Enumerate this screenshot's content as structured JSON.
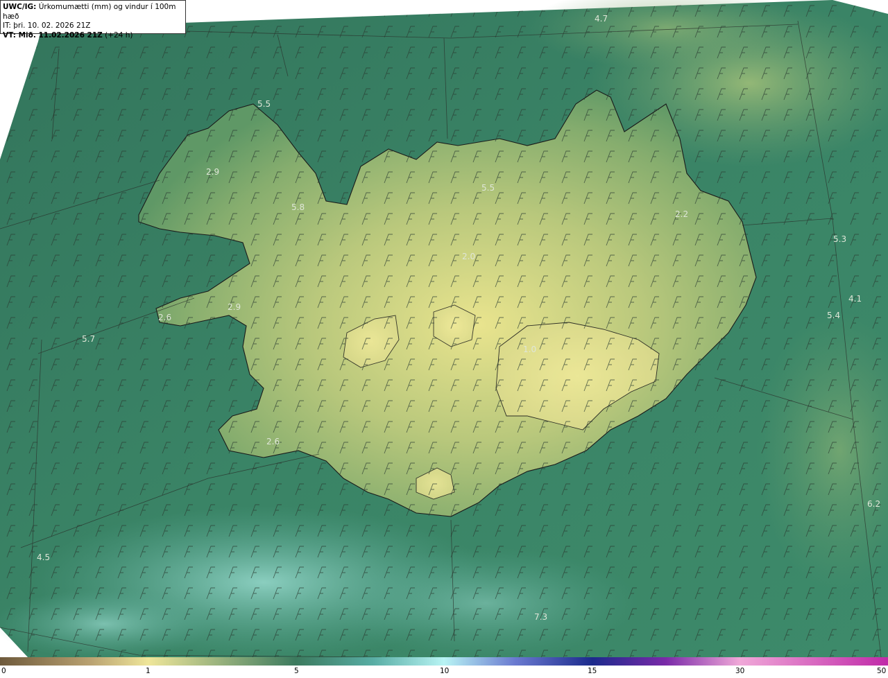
{
  "header": {
    "line1_bold": "UWC/IG:",
    "line1_text": "Úrkomumætti (mm) og vindur í 100m hæð",
    "line2_text": "IT: þri. 10. 02. 2026 21Z",
    "line3_bold": "VT: Mið. 11.02.2026 21Z",
    "line3_text": "(+24 h)"
  },
  "map_values": [
    {
      "text": "4.7"
    },
    {
      "text": "5.5"
    },
    {
      "text": "2.9"
    },
    {
      "text": "5.8"
    },
    {
      "text": "5.5"
    },
    {
      "text": "2.0"
    },
    {
      "text": "2.2"
    },
    {
      "text": "5.3"
    },
    {
      "text": "4.1"
    },
    {
      "text": "5.4"
    },
    {
      "text": "2.9"
    },
    {
      "text": "2.6"
    },
    {
      "text": "5.7"
    },
    {
      "text": "1.0"
    },
    {
      "text": "2.6"
    },
    {
      "text": "6.2"
    },
    {
      "text": "4.5"
    },
    {
      "text": "7.3"
    }
  ],
  "colorbar": {
    "ticks": [
      "0",
      "1",
      "5",
      "10",
      "15",
      "30",
      "50"
    ],
    "colors": {
      "brown": "#6e5a3c",
      "tan": "#b8a070",
      "pale_yellow": "#efe69a",
      "green": "#3c7a5e",
      "teal": "#58ada4",
      "cyan": "#b8f4f4",
      "navy": "#1c2a8c",
      "purple": "#7a2aa8",
      "pink": "#f0a8d8",
      "magenta": "#c02aa8"
    }
  }
}
